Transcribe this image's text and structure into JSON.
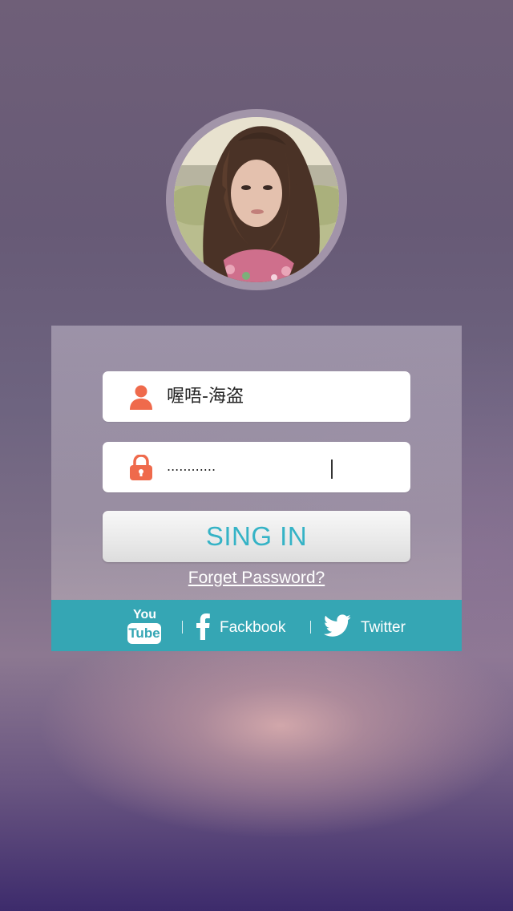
{
  "profile": {
    "avatar_icon": "user-photo"
  },
  "login_form": {
    "username": {
      "icon": "user-icon",
      "value": "喔唔-海盗"
    },
    "password": {
      "icon": "lock-icon",
      "masked_value": "............"
    },
    "signin_label": "SING IN",
    "forgot_label": "Forget Password?"
  },
  "social": {
    "youtube": {
      "you": "You",
      "tube": "Tube",
      "icon": "youtube-icon"
    },
    "facebook": {
      "label": "Fackbook",
      "icon": "facebook-icon"
    },
    "twitter": {
      "label": "Twitter",
      "icon": "twitter-icon"
    }
  },
  "colors": {
    "accent": "#35b3c6",
    "social_bar": "#35a6b4",
    "icon_orange": "#ef6a4c"
  }
}
